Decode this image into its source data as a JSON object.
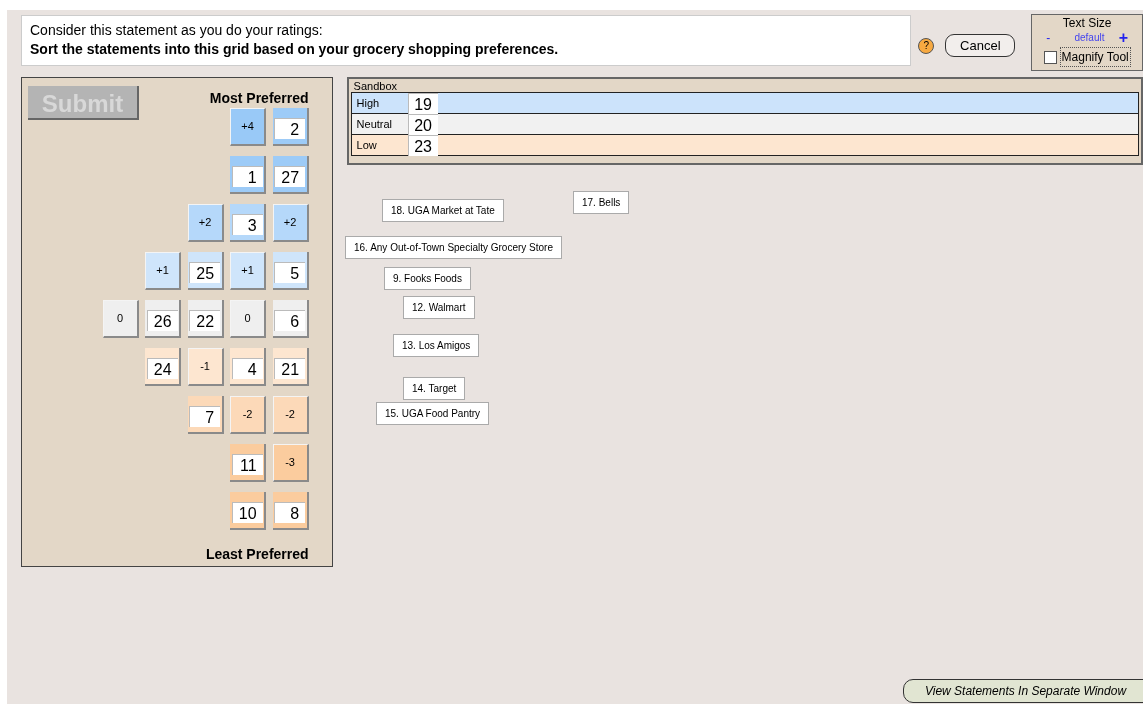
{
  "prompt": {
    "intro": "Consider this statement as you do your ratings:",
    "statement": "Sort the statements into this grid based on your grocery shopping preferences."
  },
  "help": {
    "label": "?"
  },
  "cancel": {
    "label": "Cancel"
  },
  "text_size": {
    "title": "Text Size",
    "minus": "-",
    "current": "default",
    "plus": "+",
    "magnify": {
      "label": "Magnify Tool",
      "checked": false
    }
  },
  "grid": {
    "submit": {
      "label": "Submit",
      "disabled": true
    },
    "top_label": "Most Preferred",
    "bottom_label": "Least Preferred",
    "rows": [
      {
        "cells": [
          {
            "kind": "header",
            "text": "+4",
            "color": "#99c9f7"
          },
          {
            "kind": "slot",
            "text": "2",
            "color": "#9dcbf7"
          }
        ]
      },
      {
        "cells": [
          {
            "kind": "slot",
            "text": "1",
            "color": "#9dcbf7"
          },
          {
            "kind": "slot",
            "text": "27",
            "color": "#9dcbf7"
          }
        ]
      },
      {
        "cells": [
          {
            "kind": "header",
            "text": "+2",
            "color": "#b5d8fa"
          },
          {
            "kind": "slot",
            "text": "3",
            "color": "#b5d8fa"
          },
          {
            "kind": "header",
            "text": "+2",
            "color": "#b5d8fa"
          }
        ]
      },
      {
        "cells": [
          {
            "kind": "header",
            "text": "+1",
            "color": "#cfe5fb"
          },
          {
            "kind": "slot",
            "text": "25",
            "color": "#cfe5fb"
          },
          {
            "kind": "header",
            "text": "+1",
            "color": "#cfe5fb"
          },
          {
            "kind": "slot",
            "text": "5",
            "color": "#cfe5fb"
          }
        ]
      },
      {
        "cells": [
          {
            "kind": "header",
            "text": "0",
            "color": "#efefef"
          },
          {
            "kind": "slot",
            "text": "26",
            "color": "#efefef"
          },
          {
            "kind": "slot",
            "text": "22",
            "color": "#efefef"
          },
          {
            "kind": "header",
            "text": "0",
            "color": "#efefef"
          },
          {
            "kind": "slot",
            "text": "6",
            "color": "#efefef"
          }
        ]
      },
      {
        "cells": [
          {
            "kind": "slot",
            "text": "24",
            "color": "#fde6d0"
          },
          {
            "kind": "header",
            "text": "-1",
            "color": "#fde6d0"
          },
          {
            "kind": "slot",
            "text": "4",
            "color": "#fde6d0"
          },
          {
            "kind": "slot",
            "text": "21",
            "color": "#fde6d0"
          }
        ]
      },
      {
        "cells": [
          {
            "kind": "slot",
            "text": "7",
            "color": "#fcd9b8"
          },
          {
            "kind": "header",
            "text": "-2",
            "color": "#fcd9b8"
          },
          {
            "kind": "header",
            "text": "-2",
            "color": "#fcd9b8"
          }
        ]
      },
      {
        "cells": [
          {
            "kind": "slot",
            "text": "11",
            "color": "#fbcc9e"
          },
          {
            "kind": "header",
            "text": "-3",
            "color": "#fbcc9e"
          }
        ]
      },
      {
        "cells": [
          {
            "kind": "slot",
            "text": "10",
            "color": "#fbcc9e"
          },
          {
            "kind": "slot",
            "text": "8",
            "color": "#fbcc9e"
          }
        ]
      }
    ]
  },
  "sandbox": {
    "title": "Sandbox",
    "rows": [
      {
        "label": "High",
        "card": "19",
        "color": "#cce3fb"
      },
      {
        "label": "Neutral",
        "card": "20",
        "color": "#f1f1f1"
      },
      {
        "label": "Low",
        "card": "23",
        "color": "#fde6d0"
      }
    ]
  },
  "statements": [
    {
      "text": "17. Bells"
    },
    {
      "text": "18. UGA Market at Tate"
    },
    {
      "text": "16. Any Out-of-Town Specialty Grocery Store"
    },
    {
      "text": "9. Fooks Foods"
    },
    {
      "text": "12. Walmart"
    },
    {
      "text": "13. Los Amigos"
    },
    {
      "text": "14. Target"
    },
    {
      "text": "15. UGA Food Pantry"
    }
  ],
  "view_button": {
    "label": "View Statements In Separate Window"
  }
}
